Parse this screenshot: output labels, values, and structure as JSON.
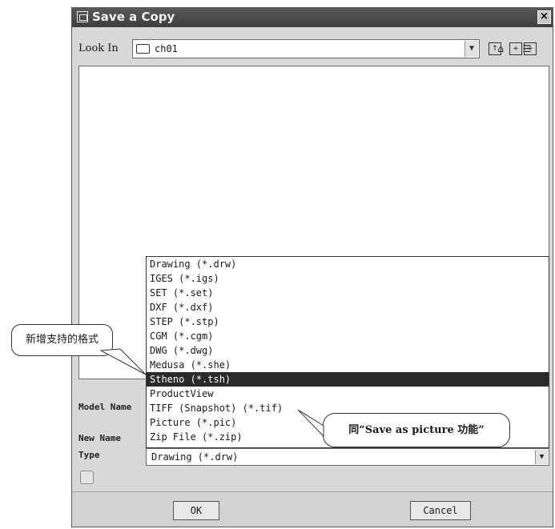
{
  "dialog": {
    "title": "Save a Copy",
    "close_label": "×",
    "look_in_label": "Look In",
    "look_in_value": "ch01",
    "fields": {
      "model_name_label": "Model Name",
      "new_name_label": "New Name",
      "type_label": "Type",
      "type_value": "Drawing (*.drw)"
    },
    "buttons": {
      "ok": "OK",
      "cancel": "Cancel"
    }
  },
  "type_options": [
    "Drawing (*.drw)",
    "IGES (*.igs)",
    "SET (*.set)",
    "DXF (*.dxf)",
    "STEP (*.stp)",
    "CGM (*.cgm)",
    "DWG (*.dwg)",
    "Medusa (*.she)",
    "Stheno (*.tsh)",
    "ProductView",
    "TIFF (Snapshot) (*.tif)",
    "Picture (*.pic)",
    "Zip File (*.zip)"
  ],
  "selected_option_index": 8,
  "annotations": {
    "left_callout": "新增支持的格式",
    "right_callout": "同“Save as picture 功能”"
  },
  "icons": {
    "folder": "folder-icon",
    "toolbar": [
      "folder-up-icon",
      "new-folder-icon",
      "new-folder-alt-icon",
      "home-folder-icon",
      "list-view-icon"
    ]
  }
}
